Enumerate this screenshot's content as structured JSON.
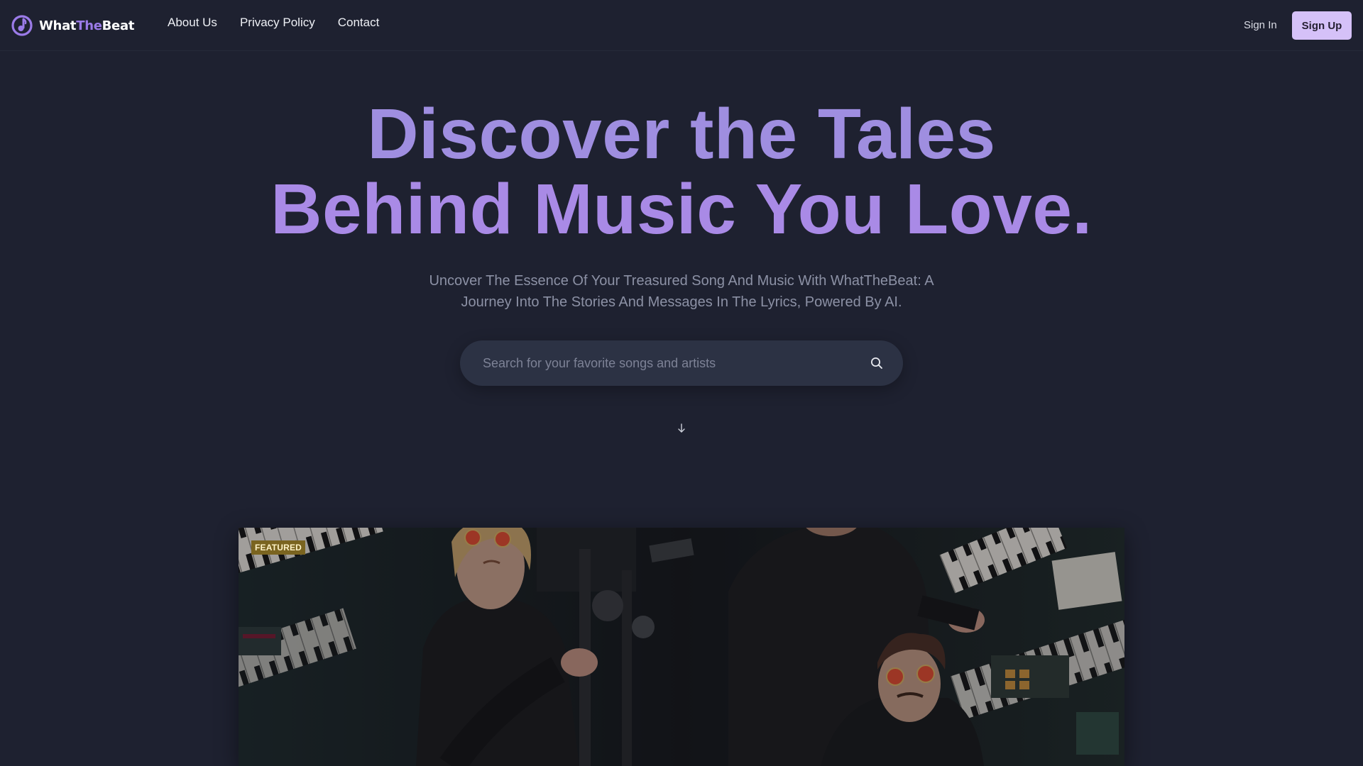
{
  "brand": {
    "name_part1": "What",
    "name_part2": "The",
    "name_part3": "Beat"
  },
  "nav": {
    "links": [
      "About Us",
      "Privacy Policy",
      "Contact"
    ],
    "sign_in": "Sign In",
    "sign_up": "Sign Up"
  },
  "hero": {
    "title_line1": "Discover the Tales",
    "title_line2": "Behind Music You Love.",
    "subtitle_line1": "Uncover The Essence Of Your Treasured Song And Music With WhatTheBeat: A",
    "subtitle_line2": "Journey Into The Stories And Messages In The Lyrics, Powered By AI."
  },
  "search": {
    "placeholder": "Search for your favorite songs and artists",
    "value": ""
  },
  "featured": {
    "badge": "FEATURED"
  },
  "icons": {
    "logo": "music-note-logo-icon",
    "search": "search-icon",
    "scroll": "arrow-down-icon"
  },
  "colors": {
    "background": "#1e2130",
    "accent": "#9b7be8",
    "sign_up_bg": "#d5c1f8",
    "badge_bg": "#7a6420"
  }
}
